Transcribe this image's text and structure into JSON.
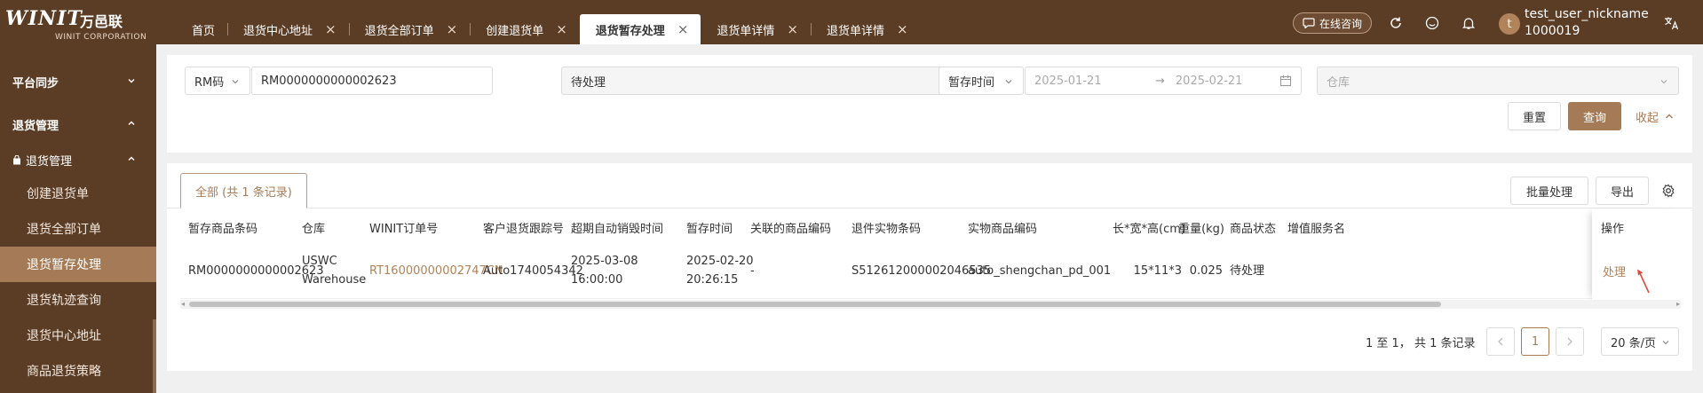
{
  "brand": {
    "logo_text": "WINIT",
    "logo_cn": "万邑联",
    "logo_sub": "WINIT CORPORATION"
  },
  "tabs": [
    {
      "label": "首页",
      "closable": false
    },
    {
      "label": "退货中心地址",
      "closable": true
    },
    {
      "label": "退货全部订单",
      "closable": true
    },
    {
      "label": "创建退货单",
      "closable": true
    },
    {
      "label": "退货暂存处理",
      "closable": true,
      "active": true
    },
    {
      "label": "退货单详情",
      "closable": true
    },
    {
      "label": "退货单详情",
      "closable": true
    }
  ],
  "header": {
    "consult_label": "在线咨询",
    "avatar_letter": "t",
    "username": "test_user_nickname",
    "user_id": "1000019"
  },
  "sidebar": {
    "group_sync": "平台同步",
    "group_return": "退货管理",
    "sub_return": "退货管理",
    "items": [
      {
        "label": "创建退货单"
      },
      {
        "label": "退货全部订单"
      },
      {
        "label": "退货暂存处理",
        "active": true
      },
      {
        "label": "退货轨迹查询"
      },
      {
        "label": "退货中心地址"
      },
      {
        "label": "商品退货策略"
      }
    ]
  },
  "filters": {
    "code_type": "RM码",
    "code_value": "RM0000000000002623",
    "status": "待处理",
    "time_type": "暂存时间",
    "date_start": "2025-01-21",
    "date_end": "2025-02-21",
    "warehouse_placeholder": "仓库",
    "reset_label": "重置",
    "query_label": "查询",
    "collapse_label": "收起"
  },
  "table": {
    "tab_label": "全部 (共 1 条记录)",
    "batch_label": "批量处理",
    "export_label": "导出",
    "columns": [
      "暂存商品条码",
      "仓库",
      "WINIT订单号",
      "客户退货跟踪号",
      "超期自动销毁时间",
      "暂存时间",
      "关联的商品编码",
      "退件实物条码",
      "实物商品编码",
      "长*宽*高(cm)",
      "重量(kg)",
      "商品状态",
      "增值服务名",
      "操作"
    ],
    "rows": [
      {
        "barcode": "RM0000000000002623",
        "warehouse_1": "USWC",
        "warehouse_2": "Warehouse",
        "order_no": "RT16000000002747CN",
        "tracking": "Auto1740054342",
        "destroy_date": "2025-03-08",
        "destroy_time": "16:00:00",
        "stash_date": "2025-02-20",
        "stash_time": "20:26:15",
        "related_code": "-",
        "return_barcode": "S512612000002046535",
        "product_code": "auto_shengchan_pd_001",
        "dimensions": "15*11*3",
        "weight": "0.025",
        "status": "待处理",
        "action": "处理"
      }
    ]
  },
  "pagination": {
    "summary": "1 至 1， 共 1 条记录",
    "current_page": "1",
    "page_size": "20 条/页"
  },
  "colors": {
    "brand_dark": "#5b3d26",
    "accent": "#a47b56",
    "link": "#b0835b"
  },
  "icons": [
    "refresh-icon",
    "smile-icon",
    "bell-icon",
    "translate-icon",
    "settings-icon",
    "calendar-icon"
  ]
}
